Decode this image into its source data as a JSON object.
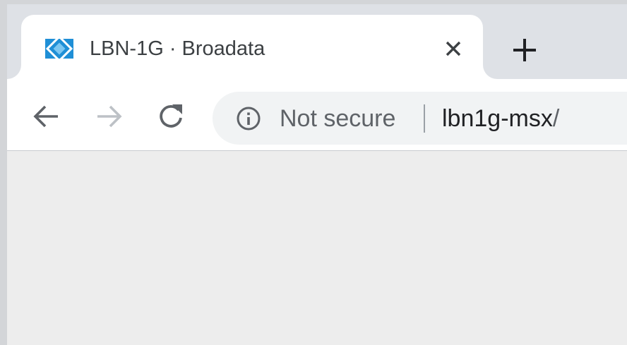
{
  "tab": {
    "title": "LBN-1G · Broadata",
    "favicon": "broadata-logo-icon",
    "close_icon": "close-icon"
  },
  "new_tab_icon": "plus-icon",
  "toolbar": {
    "back_icon": "arrow-left-icon",
    "forward_icon": "arrow-right-icon",
    "reload_icon": "reload-icon"
  },
  "omnibox": {
    "security_icon": "info-icon",
    "security_label": "Not secure",
    "url_host": "lbn1g-msx",
    "url_path": "/"
  },
  "colors": {
    "tabstrip": "#dee1e6",
    "tab": "#ffffff",
    "omnibox": "#f1f3f4",
    "content": "#ededed",
    "favicon": "#1f8fd6"
  }
}
